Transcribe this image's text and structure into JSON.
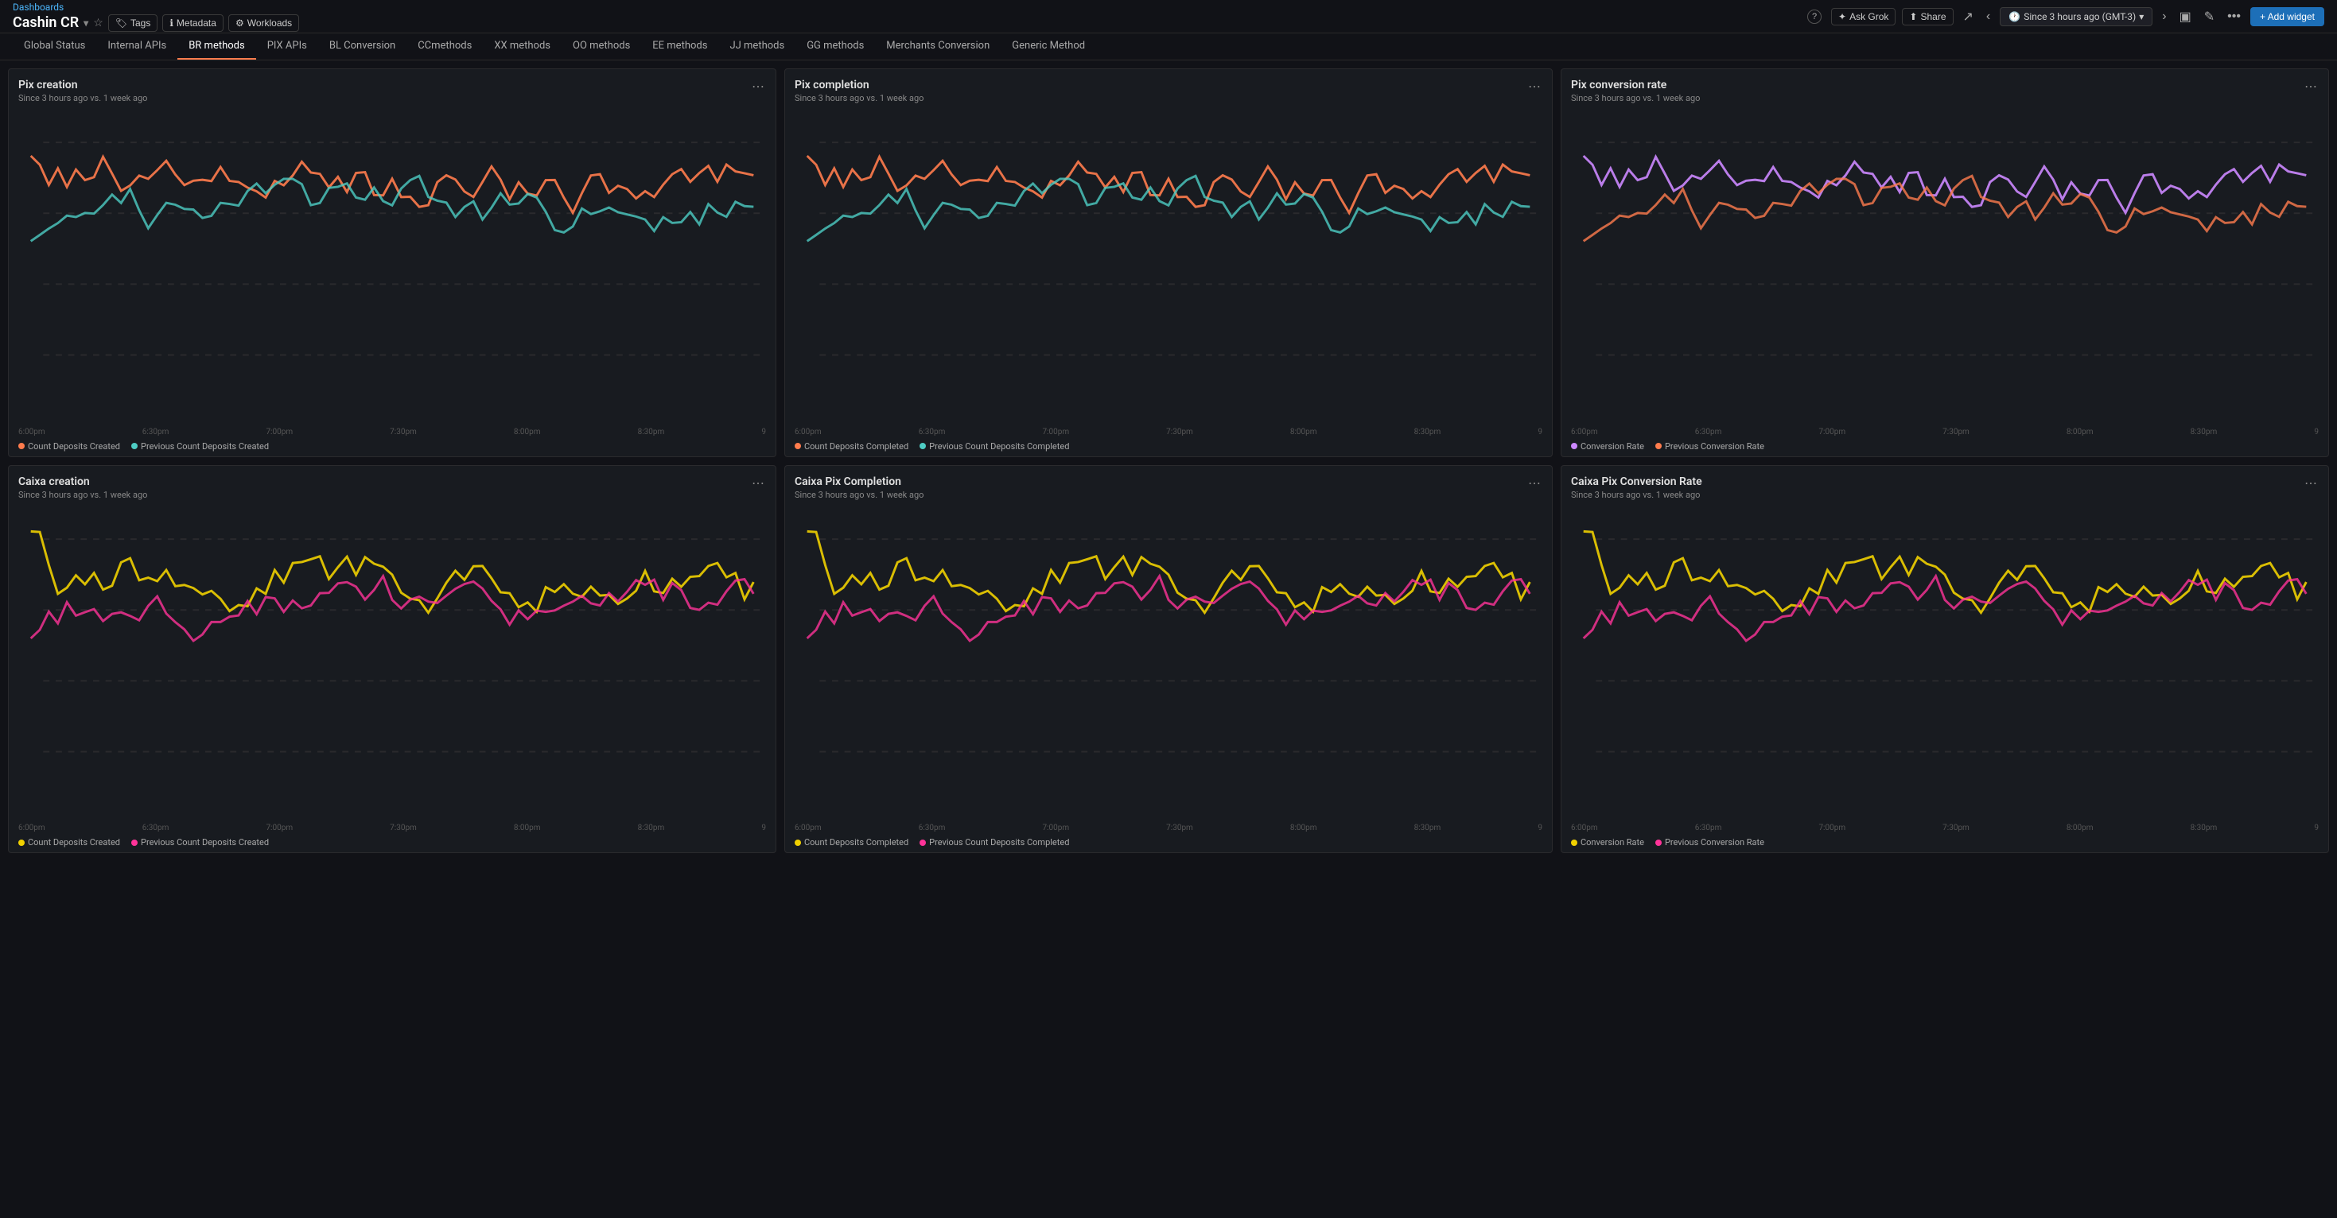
{
  "topbar": {
    "dashboards_link": "Dashboards",
    "app_title": "Cashin CR",
    "tags_label": "Tags",
    "metadata_label": "Metadata",
    "workloads_label": "Workloads",
    "time_range": "Since 3 hours ago (GMT-3)",
    "add_widget_label": "+ Add widget",
    "share_label": "Share",
    "ask_grok_label": "Ask Grok"
  },
  "navtabs": {
    "items": [
      {
        "label": "Global Status",
        "active": false
      },
      {
        "label": "Internal APIs",
        "active": false
      },
      {
        "label": "BR methods",
        "active": true
      },
      {
        "label": "PIX APIs",
        "active": false
      },
      {
        "label": "BL Conversion",
        "active": false
      },
      {
        "label": "CCmethods",
        "active": false
      },
      {
        "label": "XX methods",
        "active": false
      },
      {
        "label": "OO methods",
        "active": false
      },
      {
        "label": "EE methods",
        "active": false
      },
      {
        "label": "JJ methods",
        "active": false
      },
      {
        "label": "GG methods",
        "active": false
      },
      {
        "label": "Merchants Conversion",
        "active": false
      },
      {
        "label": "Generic Method",
        "active": false
      }
    ]
  },
  "panels": [
    {
      "id": "pix-creation",
      "title": "Pix creation",
      "subtitle": "Since 3 hours ago vs. 1 week ago",
      "legend": [
        {
          "label": "Count Deposits Created",
          "color": "#ff7c4d"
        },
        {
          "label": "Previous Count Deposits Created",
          "color": "#4ecdc4"
        }
      ],
      "x_labels": [
        "6:00pm",
        "6:30pm",
        "7:00pm",
        "7:30pm",
        "8:00pm",
        "8:30pm",
        "9"
      ],
      "line1_color": "#ff7c4d",
      "line2_color": "#4ecdc4"
    },
    {
      "id": "pix-completion",
      "title": "Pix completion",
      "subtitle": "Since 3 hours ago vs. 1 week ago",
      "legend": [
        {
          "label": "Count Deposits Completed",
          "color": "#ff7c4d"
        },
        {
          "label": "Previous Count Deposits Completed",
          "color": "#4ecdc4"
        }
      ],
      "x_labels": [
        "6:00pm",
        "6:30pm",
        "7:00pm",
        "7:30pm",
        "8:00pm",
        "8:30pm",
        "9"
      ],
      "line1_color": "#ff7c4d",
      "line2_color": "#4ecdc4"
    },
    {
      "id": "pix-conversion-rate",
      "title": "Pix conversion rate",
      "subtitle": "Since 3 hours ago vs. 1 week ago",
      "legend": [
        {
          "label": "Conversion Rate",
          "color": "#cc88ff"
        },
        {
          "label": "Previous Conversion Rate",
          "color": "#ff7c4d"
        }
      ],
      "x_labels": [
        "6:00pm",
        "6:30pm",
        "7:00pm",
        "7:30pm",
        "8:00pm",
        "8:30pm",
        "9"
      ],
      "line1_color": "#cc88ff",
      "line2_color": "#ff7c4d"
    },
    {
      "id": "caixa-creation",
      "title": "Caixa creation",
      "subtitle": "Since 3 hours ago vs. 1 week ago",
      "legend": [
        {
          "label": "Count Deposits Created",
          "color": "#f0d000"
        },
        {
          "label": "Previous Count Deposits Created",
          "color": "#ff3399"
        }
      ],
      "x_labels": [
        "6:00pm",
        "6:30pm",
        "7:00pm",
        "7:30pm",
        "8:00pm",
        "8:30pm",
        "9"
      ],
      "line1_color": "#f0d000",
      "line2_color": "#ff3399"
    },
    {
      "id": "caixa-pix-completion",
      "title": "Caixa Pix Completion",
      "subtitle": "Since 3 hours ago vs. 1 week ago",
      "legend": [
        {
          "label": "Count Deposits Completed",
          "color": "#f0d000"
        },
        {
          "label": "Previous Count Deposits Completed",
          "color": "#ff3399"
        }
      ],
      "x_labels": [
        "6:00pm",
        "6:30pm",
        "7:00pm",
        "7:30pm",
        "8:00pm",
        "8:30pm",
        "9"
      ],
      "line1_color": "#f0d000",
      "line2_color": "#ff3399"
    },
    {
      "id": "caixa-pix-conversion-rate",
      "title": "Caixa Pix Conversion Rate",
      "subtitle": "Since 3 hours ago vs. 1 week ago",
      "legend": [
        {
          "label": "Conversion Rate",
          "color": "#f0d000"
        },
        {
          "label": "Previous Conversion Rate",
          "color": "#ff3399"
        }
      ],
      "x_labels": [
        "6:00pm",
        "6:30pm",
        "7:00pm",
        "7:30pm",
        "8:00pm",
        "8:30pm",
        "9"
      ],
      "line1_color": "#f0d000",
      "line2_color": "#ff3399"
    }
  ],
  "icons": {
    "help": "?",
    "ask_grok": "✦",
    "share": "⬆",
    "external_link": "↗",
    "chevron_left": "‹",
    "chevron_right": "›",
    "monitor": "▣",
    "edit": "✎",
    "ellipsis": "⋯",
    "more_horiz": "•••",
    "tags_icon": "🏷",
    "meta_icon": "ℹ",
    "workloads_icon": "⚙",
    "star": "☆",
    "dropdown_arrow": "▾",
    "plus": "+"
  }
}
